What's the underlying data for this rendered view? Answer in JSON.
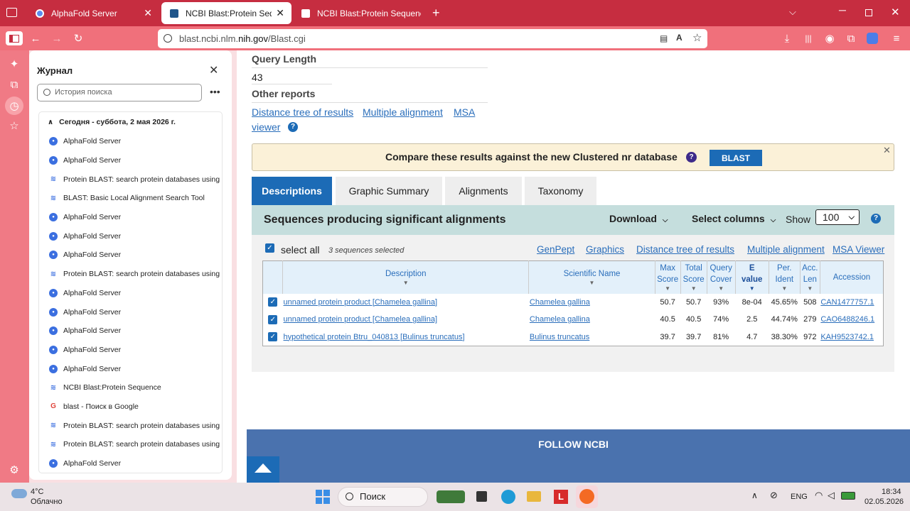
{
  "tabs": [
    {
      "title": "AlphaFold Server"
    },
    {
      "title": "NCBI Blast:Protein Sequence"
    },
    {
      "title": "NCBI Blast:Protein Sequence"
    }
  ],
  "url": {
    "prefix": "blast.ncbi.nlm.",
    "domain": "nih.gov",
    "path": "/Blast.cgi"
  },
  "sidebar": {
    "title": "Журнал",
    "search_placeholder": "История поиска",
    "group": "Сегодня - суббота, 2 мая 2026 г.",
    "items": [
      {
        "label": "AlphaFold Server",
        "icon": "alphafold-icon"
      },
      {
        "label": "AlphaFold Server",
        "icon": "alphafold-icon"
      },
      {
        "label": "Protein BLAST: search protein databases using ...",
        "icon": "blast-icon"
      },
      {
        "label": "BLAST: Basic Local Alignment Search Tool",
        "icon": "blast-icon"
      },
      {
        "label": "AlphaFold Server",
        "icon": "alphafold-icon"
      },
      {
        "label": "AlphaFold Server",
        "icon": "alphafold-icon"
      },
      {
        "label": "AlphaFold Server",
        "icon": "alphafold-icon"
      },
      {
        "label": "Protein BLAST: search protein databases using ...",
        "icon": "blast-icon"
      },
      {
        "label": "AlphaFold Server",
        "icon": "alphafold-icon"
      },
      {
        "label": "AlphaFold Server",
        "icon": "alphafold-icon"
      },
      {
        "label": "AlphaFold Server",
        "icon": "alphafold-icon"
      },
      {
        "label": "AlphaFold Server",
        "icon": "alphafold-icon"
      },
      {
        "label": "AlphaFold Server",
        "icon": "alphafold-icon"
      },
      {
        "label": "NCBI Blast:Protein Sequence",
        "icon": "blast-icon"
      },
      {
        "label": "blast - Поиск в Google",
        "icon": "google-icon"
      },
      {
        "label": "Protein BLAST: search protein databases using ...",
        "icon": "blast-icon"
      },
      {
        "label": "Protein BLAST: search protein databases using ...",
        "icon": "blast-icon"
      },
      {
        "label": "AlphaFold Server",
        "icon": "alphafold-icon"
      }
    ]
  },
  "page": {
    "query_length_label": "Query Length",
    "query_length": "43",
    "other_reports_label": "Other reports",
    "reports": {
      "distance_tree": "Distance tree of results",
      "multiple_alignment": "Multiple alignment",
      "msa": "MSA",
      "viewer": "viewer"
    },
    "banner_text": "Compare these results against the new Clustered nr database",
    "banner_button": "BLAST",
    "tabs": [
      "Descriptions",
      "Graphic Summary",
      "Alignments",
      "Taxonomy"
    ],
    "panel_title": "Sequences producing significant alignments",
    "download": "Download",
    "select_columns": "Select columns",
    "show_label": "Show",
    "show_value": "100",
    "select_all": "select all",
    "selected_count": "3 sequences selected",
    "links": [
      "GenPept",
      "Graphics",
      "Distance tree of results",
      "Multiple alignment",
      "MSA Viewer"
    ],
    "columns": {
      "description": "Description",
      "scientific": "Scientific Name",
      "max1": "Max",
      "max2": "Score",
      "total1": "Total",
      "total2": "Score",
      "qc1": "Query",
      "qc2": "Cover",
      "e1": "E",
      "e2": "value",
      "pi1": "Per.",
      "pi2": "Ident",
      "al1": "Acc.",
      "al2": "Len",
      "accession": "Accession"
    },
    "rows": [
      {
        "description": "unnamed protein product [Chamelea gallina]",
        "scientific": "Chamelea gallina",
        "max": "50.7",
        "total": "50.7",
        "cover": "93%",
        "evalue": "8e-04",
        "ident": "45.65%",
        "len": "508",
        "acc": "CAN1477757.1"
      },
      {
        "description": "unnamed protein product [Chamelea gallina]",
        "scientific": "Chamelea gallina",
        "max": "40.5",
        "total": "40.5",
        "cover": "74%",
        "evalue": "2.5",
        "ident": "44.74%",
        "len": "279",
        "acc": "CAO6488246.1"
      },
      {
        "description": "hypothetical protein Btru_040813 [Bulinus truncatus]",
        "scientific": "Bulinus truncatus",
        "max": "39.7",
        "total": "39.7",
        "cover": "81%",
        "evalue": "4.7",
        "ident": "38.30%",
        "len": "972",
        "acc": "KAH9523742.1"
      }
    ],
    "footer": "FOLLOW NCBI"
  },
  "taskbar": {
    "temp": "4°C",
    "weather": "Облачно",
    "search": "Поиск",
    "lang": "ENG",
    "time": "18:34",
    "date": "02.05.2026"
  }
}
